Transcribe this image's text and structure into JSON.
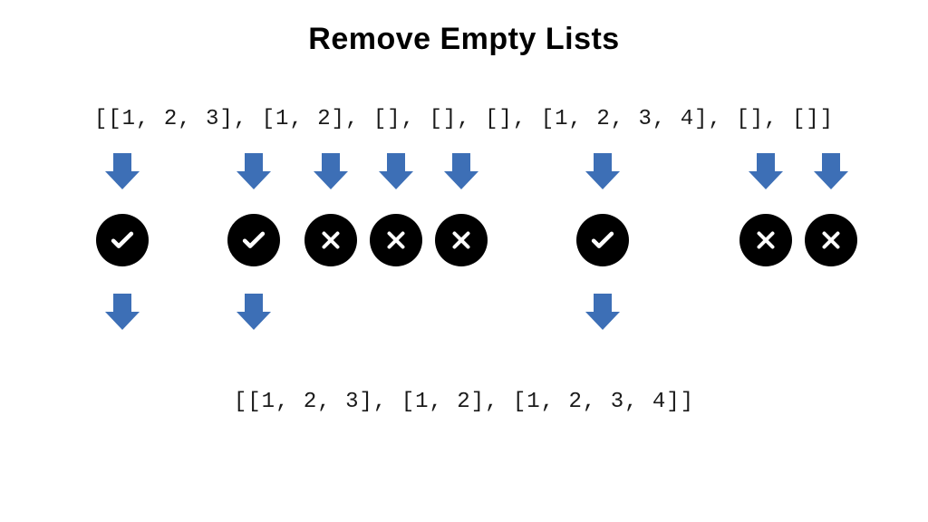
{
  "title": "Remove Empty Lists",
  "input_code": "[[1, 2, 3], [1, 2], [], [], [], [1, 2, 3, 4], [], []]",
  "output_code": "[[1, 2, 3], [1, 2], [1, 2, 3, 4]]",
  "items": [
    {
      "value": "[1, 2, 3]",
      "keep": true
    },
    {
      "value": "[1, 2]",
      "keep": true
    },
    {
      "value": "[]",
      "keep": false
    },
    {
      "value": "[]",
      "keep": false
    },
    {
      "value": "[]",
      "keep": false
    },
    {
      "value": "[1, 2, 3, 4]",
      "keep": true
    },
    {
      "value": "[]",
      "keep": false
    },
    {
      "value": "[]",
      "keep": false
    }
  ],
  "colors": {
    "arrow": "#3d6fb6",
    "badge_bg": "#000000",
    "badge_fg": "#ffffff"
  }
}
